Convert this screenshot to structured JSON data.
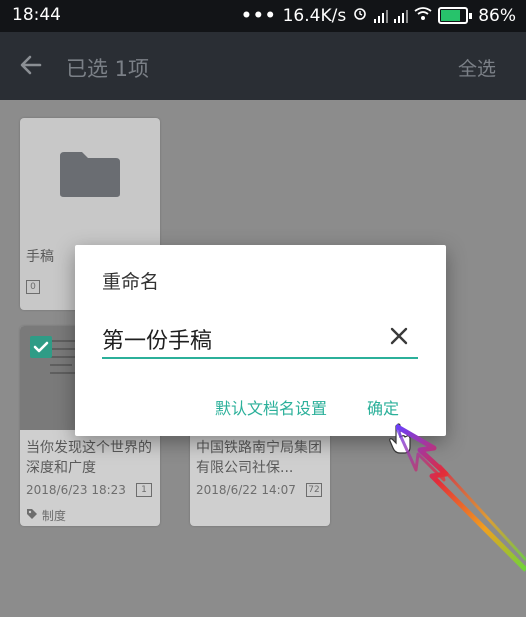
{
  "status_bar": {
    "time": "18:44",
    "dots": "•••",
    "network_speed": "16.4K/s",
    "battery_percent": "86%"
  },
  "toolbar": {
    "title": "已选 1项",
    "select_all": "全选"
  },
  "folder": {
    "label": "手稿",
    "count": "0"
  },
  "documents": [
    {
      "title": "当你发现这个世界的深度和广度",
      "date": "2018/6/23 18:23",
      "pages": "1",
      "tag": "制度"
    },
    {
      "title": "中国铁路南宁局集团有限公司社保...",
      "date": "2018/6/22 14:07",
      "pages": "72"
    }
  ],
  "dialog": {
    "title": "重命名",
    "input_value": "第一份手稿",
    "default_name_button": "默认文档名设置",
    "ok_button": "确定"
  },
  "colors": {
    "accent": "#2bb09a",
    "toolbar_bg": "#2a2e34",
    "status_bg": "#121417"
  }
}
